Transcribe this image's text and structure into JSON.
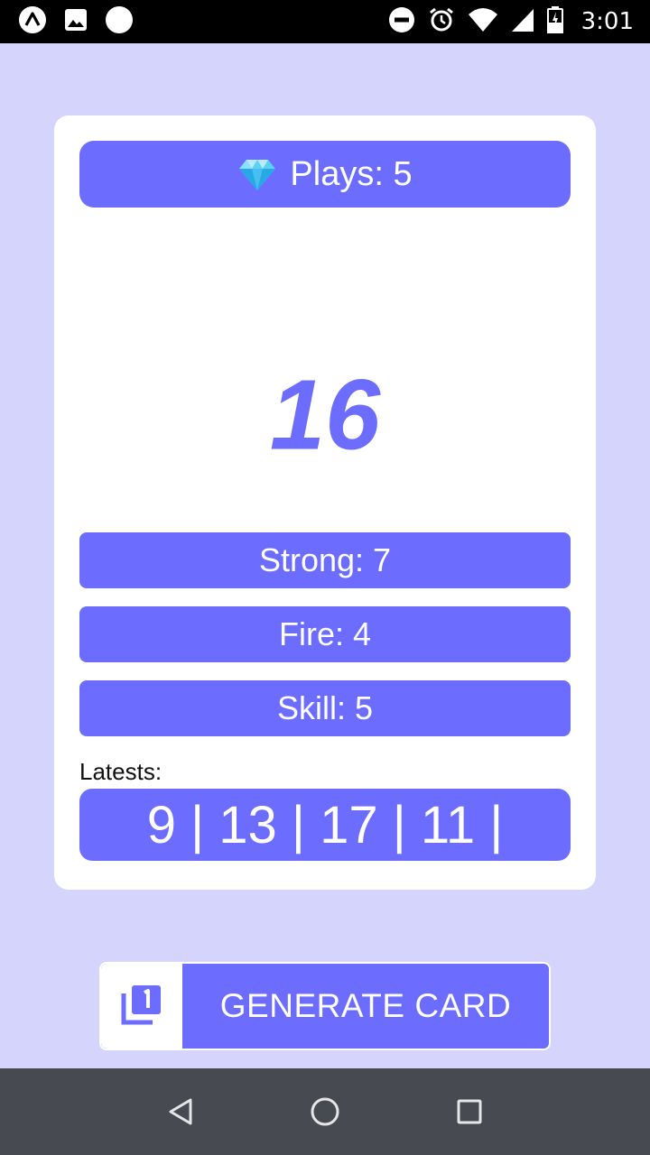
{
  "status_bar": {
    "time": "3:01",
    "left_icons": [
      "expo-icon",
      "image-icon",
      "circle-icon"
    ],
    "right_icons": [
      "do-not-disturb-icon",
      "alarm-icon",
      "wifi-icon",
      "signal-icon",
      "battery-charging-icon"
    ]
  },
  "card": {
    "plays_icon": "gem-icon",
    "plays_label": "Plays: 5",
    "current_value": "16",
    "stats": {
      "strong": "Strong: 7",
      "fire": "Fire: 4",
      "skill": "Skill: 5"
    },
    "latests_label": "Latests:",
    "latests_values": "9 | 13 | 17 | 11 |"
  },
  "generate_button": {
    "icon": "filter-1-icon",
    "label": "GENERATE CARD"
  },
  "nav_bar": {
    "icons": [
      "back-icon",
      "home-icon",
      "recents-icon"
    ]
  },
  "colors": {
    "background": "#d4d4fd",
    "accent": "#6c6cff",
    "card": "#ffffff",
    "nav_bar": "#474b51"
  }
}
